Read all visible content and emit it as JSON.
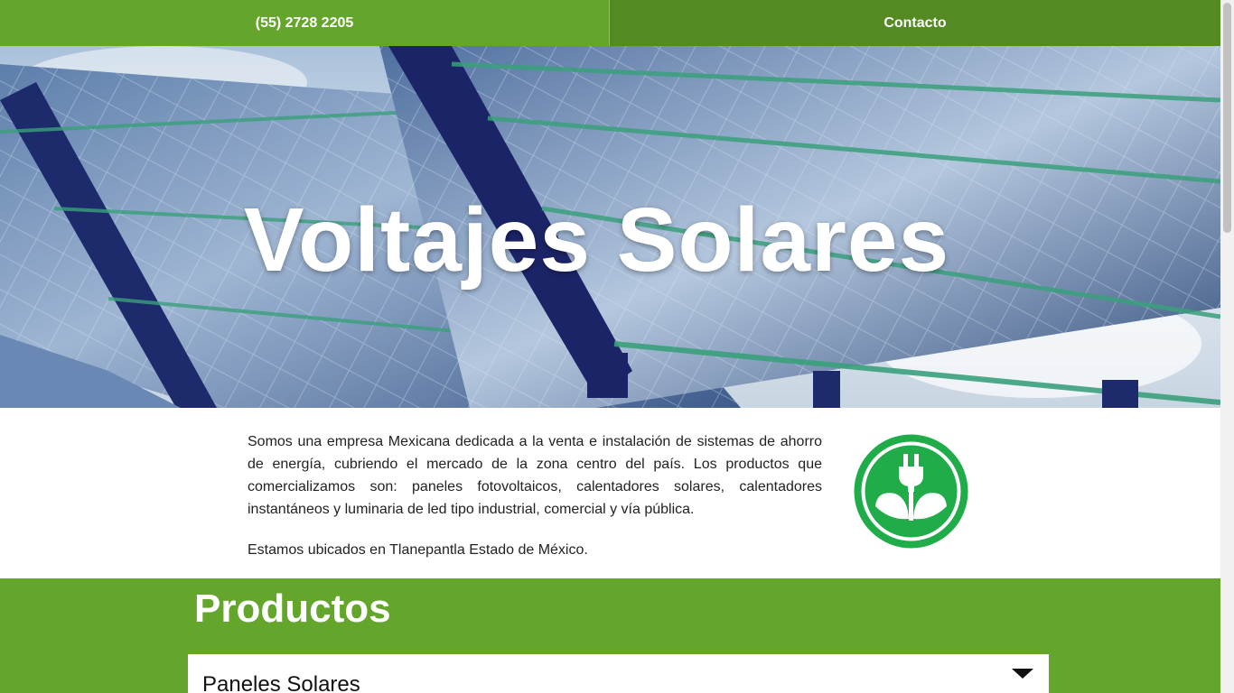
{
  "topbar": {
    "phone": "(55) 2728 2205",
    "contact": "Contacto"
  },
  "hero": {
    "title": "Voltajes Solares"
  },
  "about": {
    "paragraph1": "Somos una empresa Mexicana dedicada a la venta e instalación de sistemas de ahorro de energía, cubriendo el mercado de la zona centro del país. Los productos que comercializamos son: paneles fotovoltaicos, calentadores solares, calentadores instantáneos y luminaria de led tipo industrial, comercial y vía pública.",
    "paragraph2": "Estamos ubicados en Tlanepantla Estado de México.",
    "logo_icon": "eco-plug-leaf-icon"
  },
  "products": {
    "heading": "Productos",
    "accordion": {
      "label": "Paneles Solares",
      "toggle_icon": "caret-down-icon"
    }
  },
  "colors": {
    "primary_green": "#64a62b",
    "dark_green": "#548a22",
    "logo_green": "#1fac49"
  }
}
